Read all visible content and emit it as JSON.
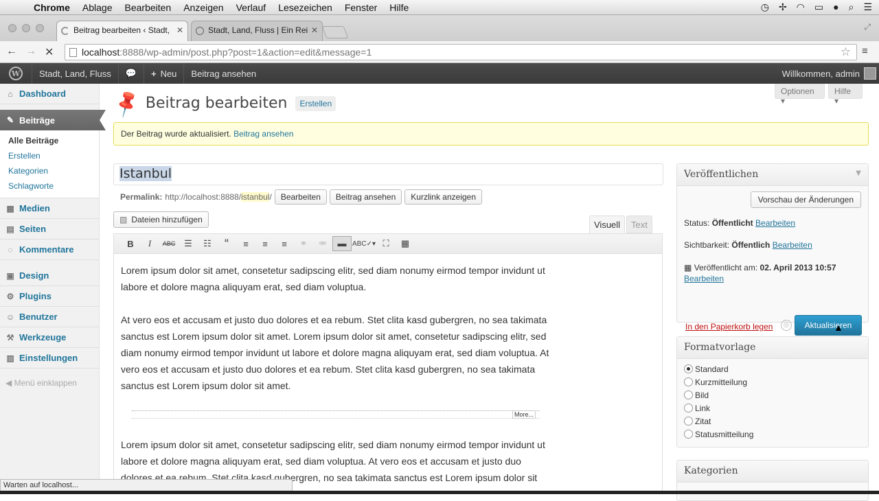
{
  "macbar": {
    "app": "Chrome",
    "menus": [
      "Ablage",
      "Bearbeiten",
      "Anzeigen",
      "Verlauf",
      "Lesezeichen",
      "Fenster",
      "Hilfe"
    ]
  },
  "tabs": [
    {
      "label": "Beitrag bearbeiten ‹ Stadt,"
    },
    {
      "label": "Stadt, Land, Fluss | Ein Rei"
    }
  ],
  "address": {
    "host": "localhost",
    "path": ":8888/wp-admin/post.php?post=1&action=edit&message=1"
  },
  "adminbar": {
    "site": "Stadt, Land, Fluss",
    "new": "Neu",
    "view": "Beitrag ansehen",
    "welcome": "Willkommen, admin"
  },
  "sidebar": {
    "dashboard": "Dashboard",
    "posts": "Beiträge",
    "posts_sub": [
      "Alle Beiträge",
      "Erstellen",
      "Kategorien",
      "Schlagworte"
    ],
    "media": "Medien",
    "pages": "Seiten",
    "comments": "Kommentare",
    "design": "Design",
    "plugins": "Plugins",
    "users": "Benutzer",
    "tools": "Werkzeuge",
    "settings": "Einstellungen",
    "collapse": "Menü einklappen"
  },
  "screen": {
    "options": "Optionen ▾",
    "help": "Hilfe ▾"
  },
  "page": {
    "title": "Beitrag bearbeiten",
    "add_new": "Erstellen"
  },
  "notice": {
    "text": "Der Beitrag wurde aktualisiert. ",
    "link": "Beitrag ansehen"
  },
  "post": {
    "title": "Istanbul",
    "permalink_label": "Permalink:",
    "permalink_base": "http://localhost:8888/",
    "permalink_slug": "istanbul",
    "permalink_end": "/",
    "edit_btn": "Bearbeiten",
    "view_btn": "Beitrag ansehen",
    "shortlink_btn": "Kurzlink anzeigen",
    "add_media": "Dateien hinzufügen",
    "tab_visual": "Visuell",
    "tab_text": "Text",
    "para1": "Lorem ipsum dolor sit amet, consetetur sadipscing elitr, sed diam nonumy eirmod tempor invidunt ut labore et dolore magna aliquyam erat, sed diam voluptua.",
    "para2": "At vero eos et accusam et justo duo dolores et ea rebum. Stet clita kasd gubergren, no sea takimata sanctus est Lorem ipsum dolor sit amet. Lorem ipsum dolor sit amet, consetetur sadipscing elitr, sed diam nonumy eirmod tempor invidunt ut labore et dolore magna aliquyam erat, sed diam voluptua. At vero eos et accusam et justo duo dolores et ea rebum. Stet clita kasd gubergren, no sea takimata sanctus est Lorem ipsum dolor sit amet.",
    "more": "More...",
    "para3": "Lorem ipsum dolor sit amet, consetetur sadipscing elitr, sed diam nonumy eirmod tempor invidunt ut labore et dolore magna aliquyam erat, sed diam voluptua. At vero eos et accusam et justo duo dolores et ea rebum. Stet clita kasd gubergren, no sea takimata sanctus est Lorem ipsum dolor sit"
  },
  "publish": {
    "title": "Veröffentlichen",
    "preview": "Vorschau der Änderungen",
    "status_label": "Status: ",
    "status_value": "Öffentlicht",
    "visibility_label": "Sichtbarkeit: ",
    "visibility_value": "Öffentlich",
    "published_label": "Veröffentlicht am: ",
    "published_value": "02. April 2013 10:57",
    "edit": "Bearbeiten",
    "trash": "In den Papierkorb legen",
    "update": "Aktualisieren"
  },
  "format": {
    "title": "Formatvorlage",
    "options": [
      "Standard",
      "Kurzmitteilung",
      "Bild",
      "Link",
      "Zitat",
      "Statusmitteilung"
    ],
    "selected": "Standard"
  },
  "categories": {
    "title": "Kategorien"
  },
  "statusbar": "Warten auf localhost..."
}
